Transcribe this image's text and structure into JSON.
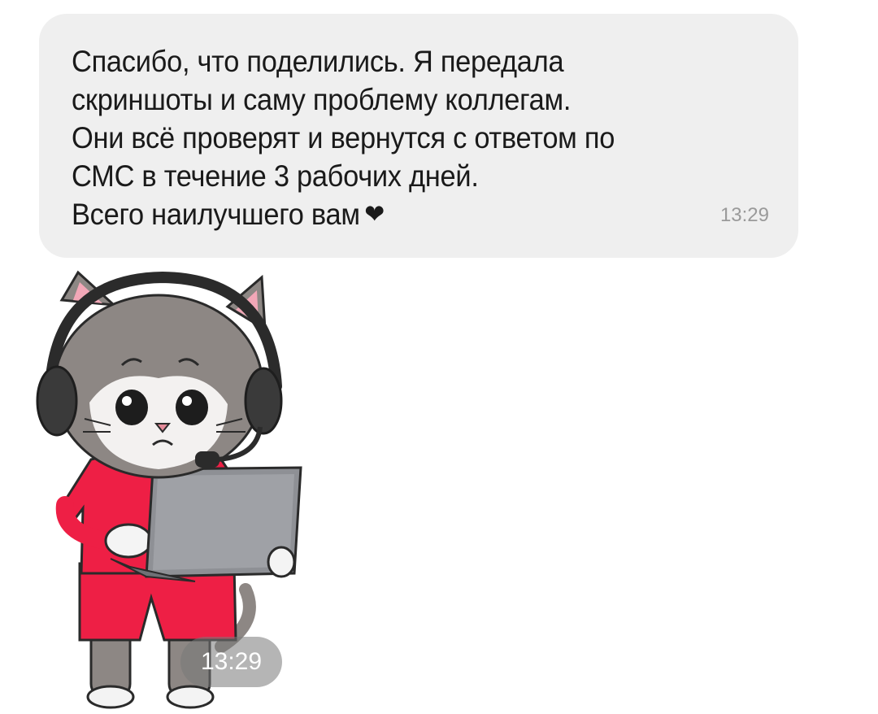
{
  "message": {
    "lines": [
      "Спасибо, что поделились. Я передала",
      "скриншоты и саму проблему коллегам.",
      "Они всё проверят и вернутся с ответом по",
      "СМС в течение 3 рабочих дней.",
      "Всего наилучшего вам"
    ],
    "heart_icon": "❤",
    "time": "13:29",
    "bubble_color": "#efefef"
  },
  "sticker": {
    "icon": "cat-operator-sticker",
    "time": "13:29",
    "shirt_color": "#ee1f45"
  }
}
